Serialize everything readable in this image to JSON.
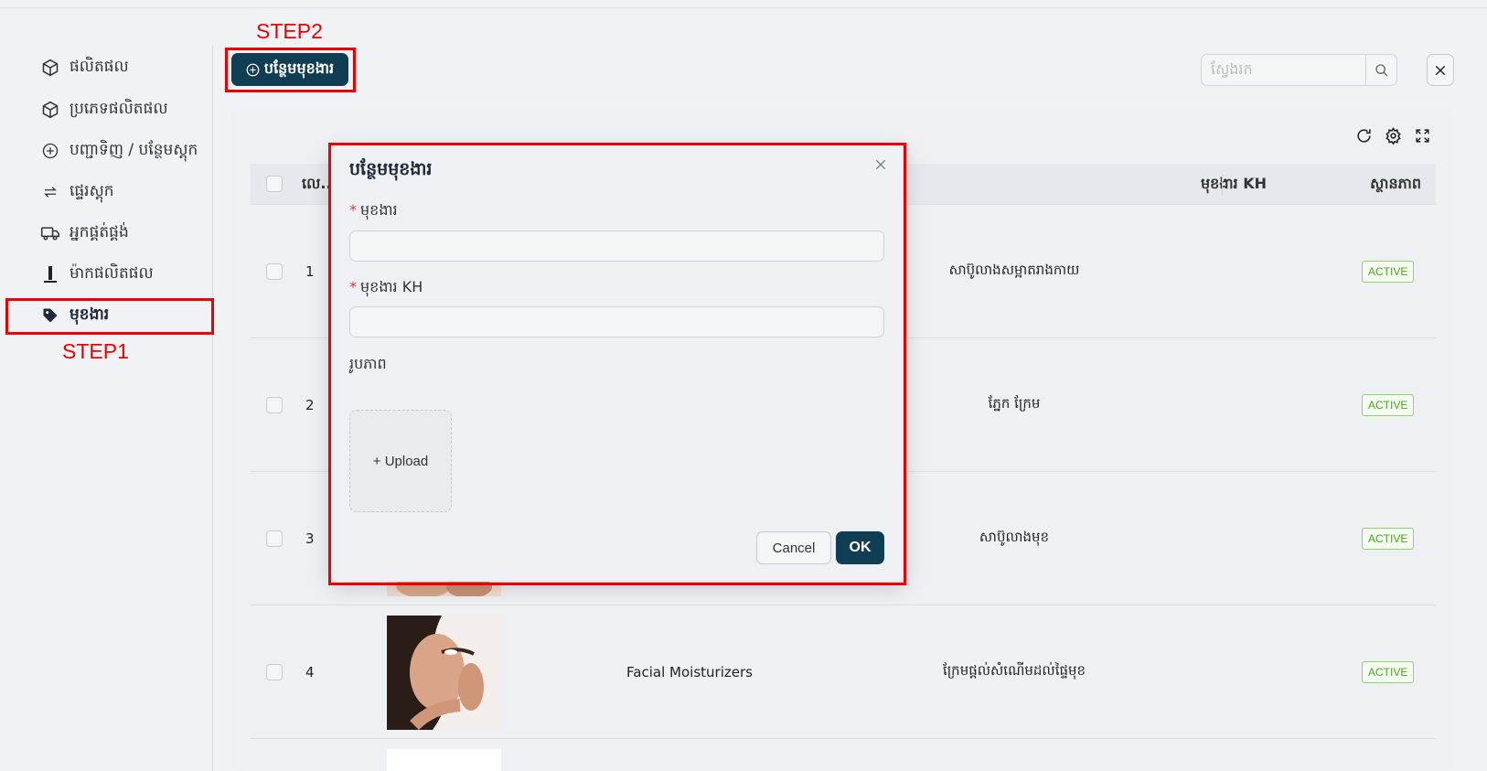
{
  "sidebar": {
    "items": [
      {
        "label": "ផលិតផល",
        "icon": "box-icon"
      },
      {
        "label": "ប្រភេទផលិតផល",
        "icon": "box-icon"
      },
      {
        "label": "បញ្ជាទិញ / បន្ថែមស្តុក",
        "icon": "plus-circle-icon"
      },
      {
        "label": "ផ្ទេរស្តុក",
        "icon": "transfer-arrows-icon"
      },
      {
        "label": "អ្នកផ្គត់ផ្គង់",
        "icon": "truck-icon"
      },
      {
        "label": "ម៉ាកផលិតផល",
        "icon": "brand-bar-icon"
      },
      {
        "label": "មុខងារ",
        "icon": "tag-icon",
        "active": true
      }
    ]
  },
  "annotations": {
    "step1": "STEP1",
    "step2": "STEP2",
    "color": "#e00000"
  },
  "toolbar": {
    "add_label": "បន្ថែមមុខងារ",
    "search_placeholder": "ស្វែងរក"
  },
  "table": {
    "headers": {
      "index": "លេ...",
      "name_kh": "មុខងារ KH",
      "status": "ស្ថានភាព"
    },
    "rows": [
      {
        "index": "1",
        "name": "",
        "name_kh": "សាប៊ូលាងសម្អាតរាងកាយ",
        "status": "ACTIVE"
      },
      {
        "index": "2",
        "name": "",
        "name_kh": "ភ្នែក ក្រែម",
        "status": "ACTIVE"
      },
      {
        "index": "3",
        "name": "",
        "name_kh": "សាប៊ូលាងមុខ",
        "status": "ACTIVE"
      },
      {
        "index": "4",
        "name": "Facial Moisturizers",
        "name_kh": "ក្រែមផ្តល់សំណើមដល់ផ្ទៃមុខ",
        "status": "ACTIVE"
      }
    ]
  },
  "modal": {
    "title": "បន្ថែមមុខងារ",
    "field_name_label": "មុខងារ",
    "field_name_kh_label": "មុខងារ KH",
    "field_image_label": "រូបភាព",
    "upload_label": "+ Upload",
    "cancel_label": "Cancel",
    "ok_label": "OK"
  },
  "colors": {
    "primary": "#0f3d54",
    "active_badge": "#4aa81b",
    "required": "#e53935"
  }
}
